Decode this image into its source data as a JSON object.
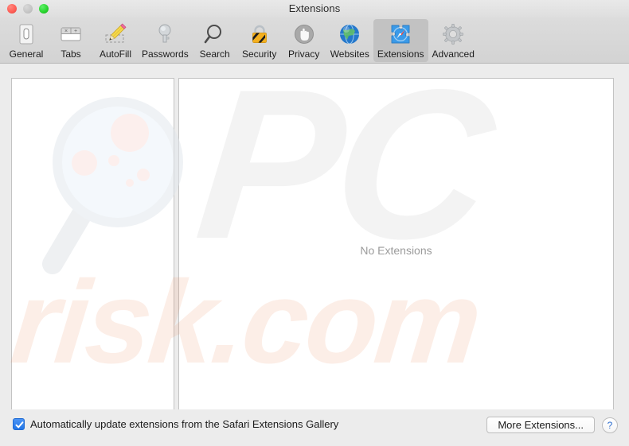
{
  "window": {
    "title": "Extensions",
    "traffic_lights": [
      {
        "name": "close",
        "color": "#ff5f57"
      },
      {
        "name": "minimize",
        "color": "#c6c6c6"
      },
      {
        "name": "zoom",
        "color": "#2ad62f"
      }
    ]
  },
  "toolbar": {
    "items": [
      {
        "label": "General",
        "icon": "general-icon",
        "selected": false
      },
      {
        "label": "Tabs",
        "icon": "tabs-icon",
        "selected": false
      },
      {
        "label": "AutoFill",
        "icon": "autofill-icon",
        "selected": false
      },
      {
        "label": "Passwords",
        "icon": "passwords-icon",
        "selected": false
      },
      {
        "label": "Search",
        "icon": "search-icon",
        "selected": false
      },
      {
        "label": "Security",
        "icon": "security-icon",
        "selected": false
      },
      {
        "label": "Privacy",
        "icon": "privacy-icon",
        "selected": false
      },
      {
        "label": "Websites",
        "icon": "websites-icon",
        "selected": false
      },
      {
        "label": "Extensions",
        "icon": "extensions-icon",
        "selected": true
      },
      {
        "label": "Advanced",
        "icon": "advanced-icon",
        "selected": false
      }
    ]
  },
  "main": {
    "extensions_list": [],
    "detail_placeholder": "No Extensions"
  },
  "bottom_bar": {
    "auto_update_label": "Automatically update extensions from the Safari Extensions Gallery",
    "auto_update_checked": true,
    "more_extensions_label": "More Extensions...",
    "help_label": "?"
  },
  "watermarks": {
    "brand_top": "PC",
    "brand_bottom": "risk.com",
    "glass_icon": "magnifying-glass-watermark"
  },
  "colors": {
    "accent": "#2176e8",
    "selected_tab": "#c2c2c2",
    "window_bg": "#ececec",
    "panel_bg": "#ffffff",
    "placeholder_text": "#9b9b9b",
    "watermark_gray": "#6f6f6f",
    "watermark_peach": "#f08a5a"
  }
}
